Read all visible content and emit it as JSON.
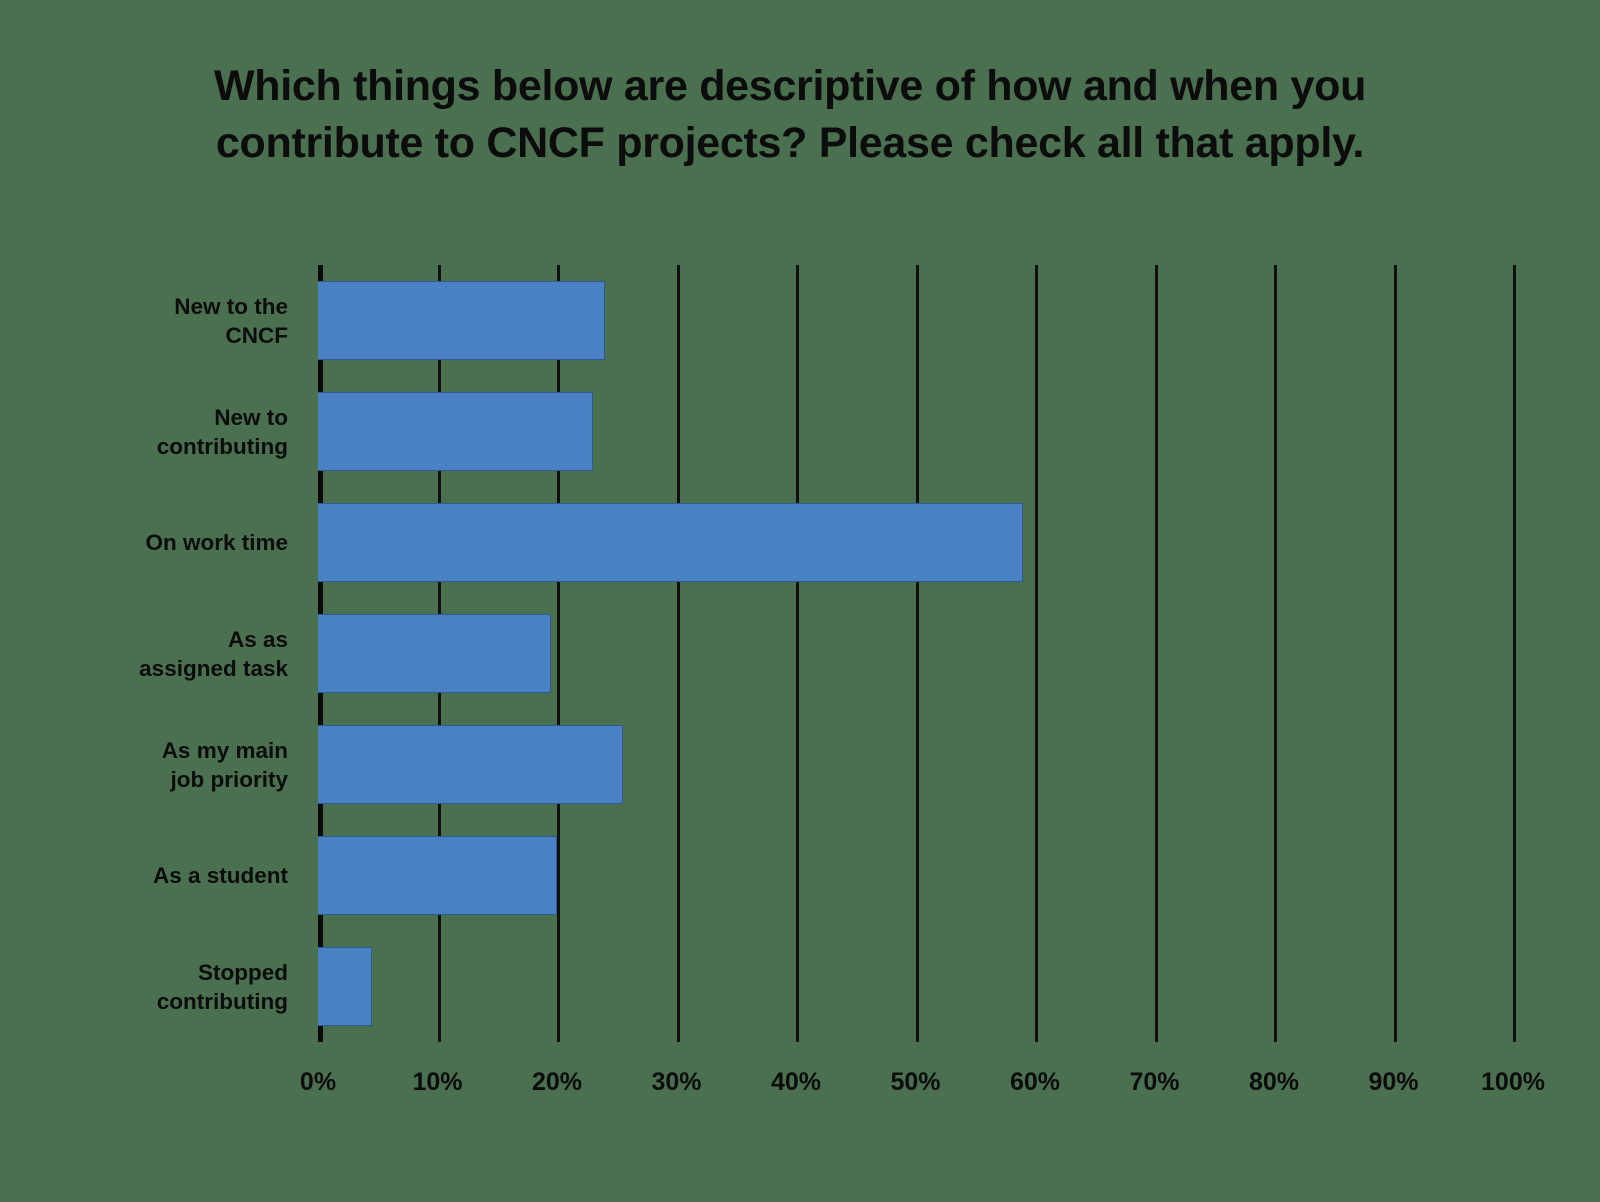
{
  "chart_data": {
    "type": "bar",
    "orientation": "horizontal",
    "title": "Which things below are descriptive of how and when you contribute to CNCF projects? Please check all that apply.",
    "xlabel": "",
    "ylabel": "",
    "categories": [
      "New to the CNCF",
      "New to contributing",
      "On work time",
      "As as assigned task",
      "As my main job priority",
      "As a student",
      "Stopped contributing"
    ],
    "category_lines": [
      [
        "New to the",
        "CNCF"
      ],
      [
        "New to",
        "contributing"
      ],
      [
        "On work time"
      ],
      [
        "As as",
        "assigned task"
      ],
      [
        "As my main",
        "job priority"
      ],
      [
        "As a student"
      ],
      [
        "Stopped",
        "contributing"
      ]
    ],
    "values": [
      24,
      23,
      59,
      19.5,
      25.5,
      20,
      4.5
    ],
    "value_labels": [
      "24%",
      "23%",
      "59%",
      "19.5%",
      "25.5%",
      "20%",
      "4.5%"
    ],
    "xlim": [
      0,
      100
    ],
    "xticks": [
      0,
      10,
      20,
      30,
      40,
      50,
      60,
      70,
      80,
      90,
      100
    ],
    "xtick_labels": [
      "0%",
      "10%",
      "20%",
      "30%",
      "40%",
      "50%",
      "60%",
      "70%",
      "80%",
      "90%",
      "100%"
    ],
    "grid": true,
    "grid_axis": "x",
    "legend": false,
    "bar_color": "#4a80c4",
    "bar_edge_color": "#2d5b96",
    "background_color": "#4a7050",
    "text_color": "#0c0c0c",
    "gridline_color": "#101010"
  }
}
